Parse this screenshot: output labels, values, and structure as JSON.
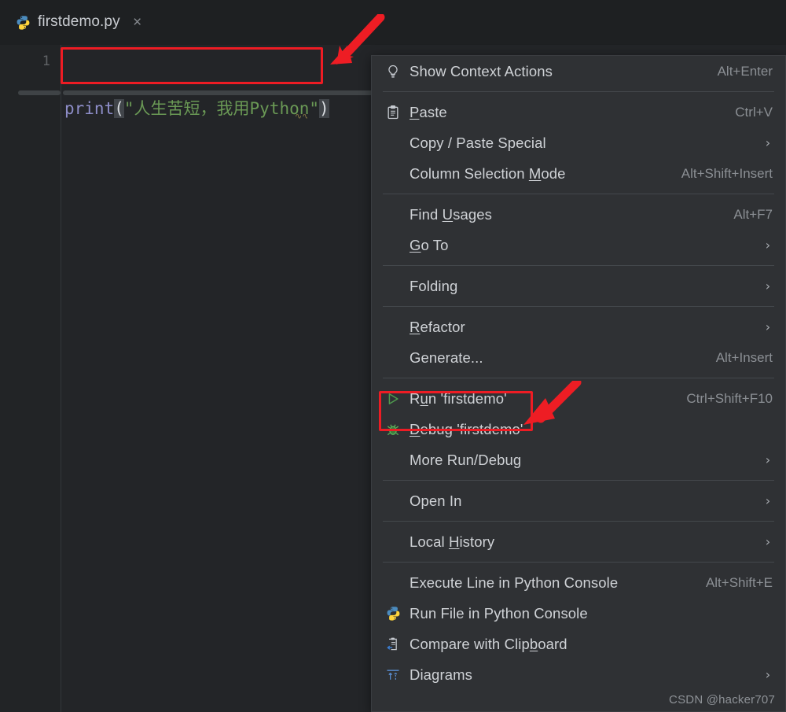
{
  "window": {
    "app": "PyCharm",
    "theme_bg": "#232528",
    "menu_bg": "#2f3134",
    "accent_red": "#ed1c24"
  },
  "tab": {
    "icon": "python-file-icon",
    "title": "firstdemo.py",
    "close": "×"
  },
  "editor": {
    "line_number": "1",
    "code": {
      "fn": "print",
      "paren_open": "(",
      "string_open_quote": "\"",
      "string_text": "人生苦短，我用Python",
      "string_close_quote": "\"",
      "paren_close": ")",
      "full": "print(\"人生苦短，我用Python\")"
    },
    "colors": {
      "function": "#8e8ec9",
      "string": "#6a9955",
      "paren": "#c8ccd0",
      "linenumber": "#606366"
    }
  },
  "context_menu": {
    "items": [
      {
        "type": "item",
        "icon": "lightbulb-icon",
        "label": "Show Context Actions",
        "mnemonic": "",
        "shortcut": "Alt+Enter",
        "submenu": false
      },
      {
        "type": "separator"
      },
      {
        "type": "item",
        "icon": "clipboard-icon",
        "label": "Paste",
        "mnemonic": "P",
        "shortcut": "Ctrl+V",
        "submenu": false
      },
      {
        "type": "item",
        "icon": "",
        "label": "Copy / Paste Special",
        "mnemonic": "",
        "shortcut": "",
        "submenu": true
      },
      {
        "type": "item",
        "icon": "",
        "label": "Column Selection Mode",
        "mnemonic": "M",
        "shortcut": "Alt+Shift+Insert",
        "submenu": false
      },
      {
        "type": "separator"
      },
      {
        "type": "item",
        "icon": "",
        "label": "Find Usages",
        "mnemonic": "U",
        "shortcut": "Alt+F7",
        "submenu": false
      },
      {
        "type": "item",
        "icon": "",
        "label": "Go To",
        "mnemonic": "G",
        "shortcut": "",
        "submenu": true
      },
      {
        "type": "separator"
      },
      {
        "type": "item",
        "icon": "",
        "label": "Folding",
        "mnemonic": "",
        "shortcut": "",
        "submenu": true
      },
      {
        "type": "separator"
      },
      {
        "type": "item",
        "icon": "",
        "label": "Refactor",
        "mnemonic": "R",
        "shortcut": "",
        "submenu": true
      },
      {
        "type": "item",
        "icon": "",
        "label": "Generate...",
        "mnemonic": "",
        "shortcut": "Alt+Insert",
        "submenu": false
      },
      {
        "type": "separator"
      },
      {
        "type": "item",
        "icon": "run-play-icon",
        "label": "Run 'firstdemo'",
        "mnemonic": "u",
        "shortcut": "Ctrl+Shift+F10",
        "submenu": false,
        "highlighted": true
      },
      {
        "type": "item",
        "icon": "debug-bug-icon",
        "label": "Debug 'firstdemo'",
        "mnemonic": "D",
        "shortcut": "",
        "submenu": false
      },
      {
        "type": "item",
        "icon": "",
        "label": "More Run/Debug",
        "mnemonic": "",
        "shortcut": "",
        "submenu": true
      },
      {
        "type": "separator"
      },
      {
        "type": "item",
        "icon": "",
        "label": "Open In",
        "mnemonic": "",
        "shortcut": "",
        "submenu": true
      },
      {
        "type": "separator"
      },
      {
        "type": "item",
        "icon": "",
        "label": "Local History",
        "mnemonic": "H",
        "shortcut": "",
        "submenu": true
      },
      {
        "type": "separator"
      },
      {
        "type": "item",
        "icon": "",
        "label": "Execute Line in Python Console",
        "mnemonic": "",
        "shortcut": "Alt+Shift+E",
        "submenu": false
      },
      {
        "type": "item",
        "icon": "python-console-icon",
        "label": "Run File in Python Console",
        "mnemonic": "",
        "shortcut": "",
        "submenu": false
      },
      {
        "type": "item",
        "icon": "compare-clipboard-icon",
        "label": "Compare with Clipboard",
        "mnemonic": "b",
        "shortcut": "",
        "submenu": false
      },
      {
        "type": "item",
        "icon": "diagrams-icon",
        "label": "Diagrams",
        "mnemonic": "",
        "shortcut": "",
        "submenu": true
      }
    ]
  },
  "annotations": {
    "arrows": [
      "arrow-pointing-to-code",
      "arrow-pointing-to-run-item"
    ],
    "boxes": [
      "code-highlight-box",
      "run-item-highlight-box"
    ]
  },
  "watermark": {
    "text": "CSDN @hacker707"
  }
}
